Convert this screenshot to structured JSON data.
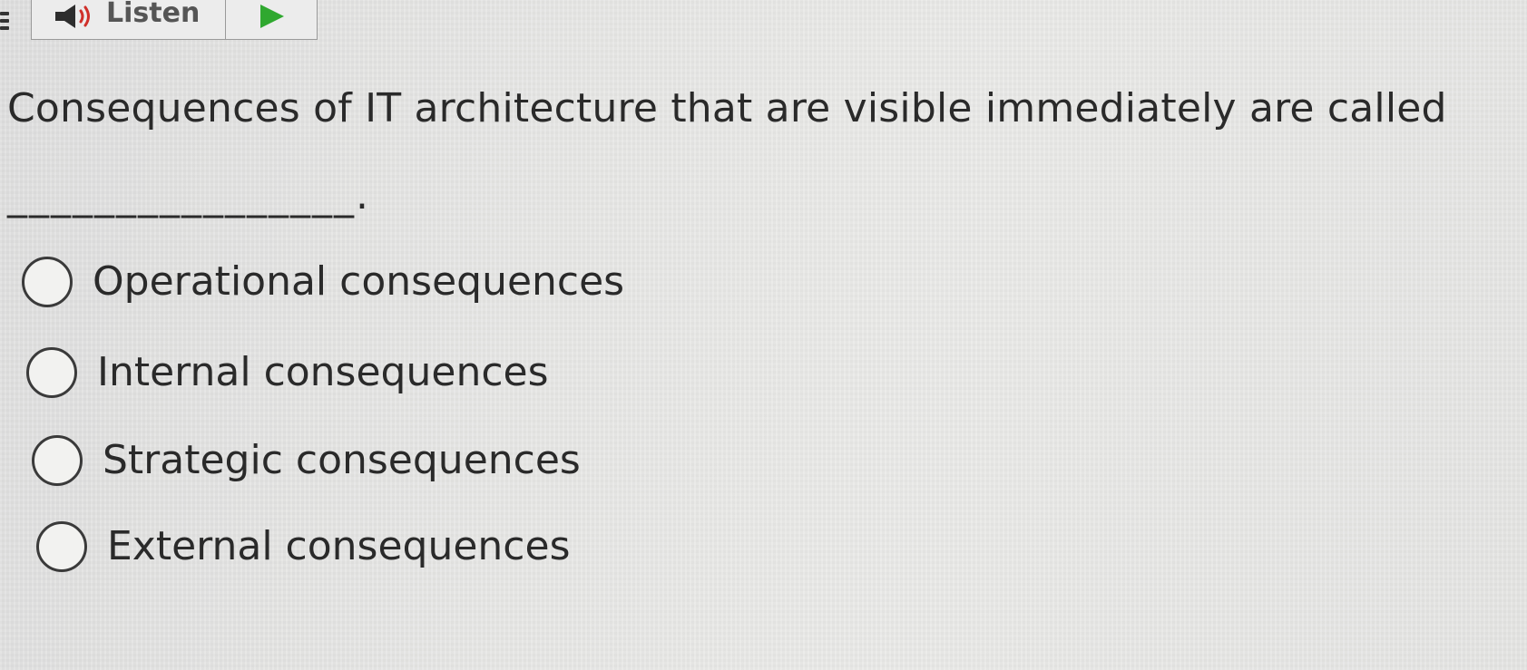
{
  "toolbar": {
    "listen_label": "Listen",
    "speaker_icon": "speaker-icon",
    "play_icon": "play-icon",
    "play_color": "#2fa82f"
  },
  "question": {
    "text": "Consequences of IT architecture that are visible immediately are called",
    "blank": "________________."
  },
  "options": [
    {
      "label": "Operational consequences",
      "selected": false
    },
    {
      "label": "Internal consequences",
      "selected": false
    },
    {
      "label": "Strategic consequences",
      "selected": false
    },
    {
      "label": "External consequences",
      "selected": false
    }
  ]
}
